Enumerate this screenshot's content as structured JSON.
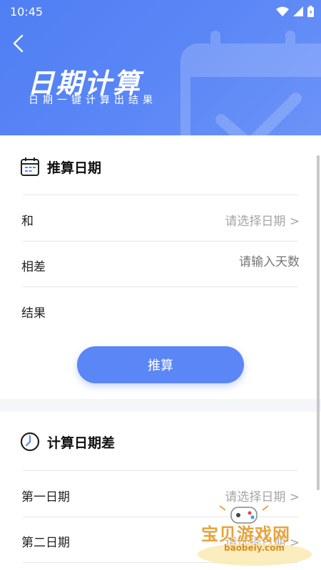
{
  "status": {
    "time": "10:45"
  },
  "header": {
    "title": "日期计算",
    "subtitle": "日期一键计算出结果"
  },
  "section1": {
    "title": "推算日期",
    "rows": [
      {
        "label": "和",
        "placeholder": "请选择日期 >"
      },
      {
        "label": "相差",
        "placeholder": "请输入天数"
      },
      {
        "label": "结果",
        "value": ""
      }
    ],
    "button_label": "推算"
  },
  "section2": {
    "title": "计算日期差",
    "rows": [
      {
        "label": "第一日期",
        "placeholder": "请选择日期 >"
      },
      {
        "label": "第二日期",
        "placeholder": "请选择日期 >"
      }
    ]
  },
  "watermark": {
    "name": "宝贝游戏网",
    "url": "baobeiy.com"
  },
  "colors": {
    "accent": "#5b86f5",
    "header": "#5a86f6",
    "muted": "#a5a5a5"
  }
}
